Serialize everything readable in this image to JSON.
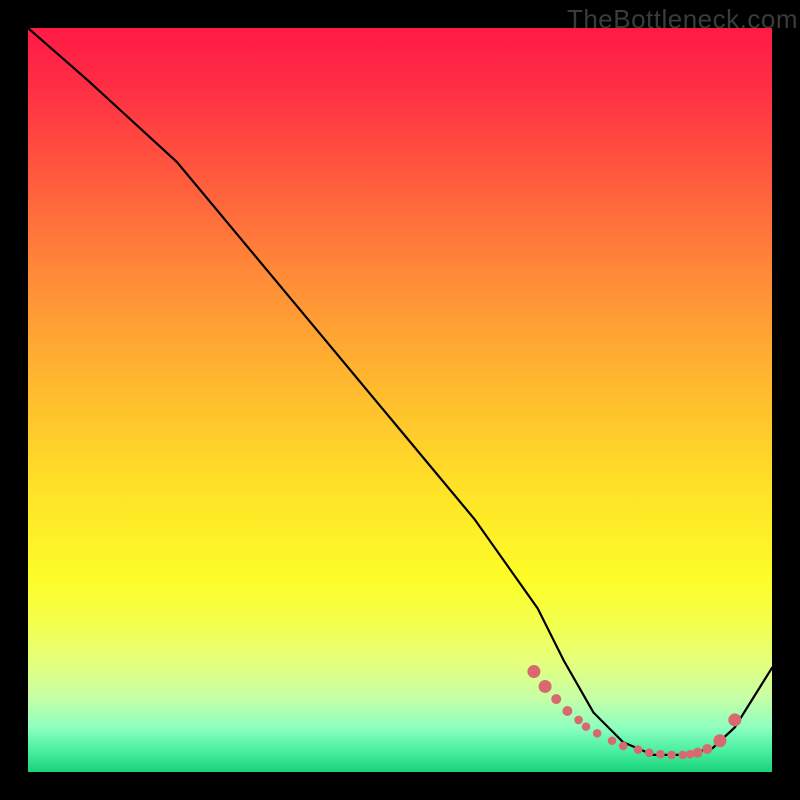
{
  "watermark": "TheBottleneck.com",
  "chart_data": {
    "type": "line",
    "title": "",
    "xlabel": "",
    "ylabel": "",
    "xlim": [
      0,
      100
    ],
    "ylim": [
      0,
      100
    ],
    "grid": false,
    "legend": false,
    "series": [
      {
        "name": "curve",
        "color": "#000000",
        "x": [
          0,
          8,
          14,
          20,
          30,
          40,
          50,
          60,
          68.5,
          72,
          76,
          80,
          84,
          88,
          92,
          95,
          100
        ],
        "y": [
          100,
          93,
          87.5,
          82,
          70,
          58,
          46,
          34,
          22,
          15,
          8,
          4,
          2.3,
          2.3,
          3.2,
          6,
          14
        ]
      }
    ],
    "markers": {
      "name": "dots",
      "color": "#d86a6f",
      "x": [
        68,
        69.5,
        71,
        72.5,
        74,
        75,
        76.5,
        78.5,
        80,
        82,
        83.5,
        85,
        86.5,
        88,
        89,
        90,
        91.3,
        93,
        95
      ],
      "y": [
        13.5,
        11.5,
        9.8,
        8.2,
        7,
        6.1,
        5.2,
        4.2,
        3.5,
        3,
        2.6,
        2.4,
        2.3,
        2.3,
        2.4,
        2.6,
        3.1,
        4.2,
        7
      ]
    }
  }
}
